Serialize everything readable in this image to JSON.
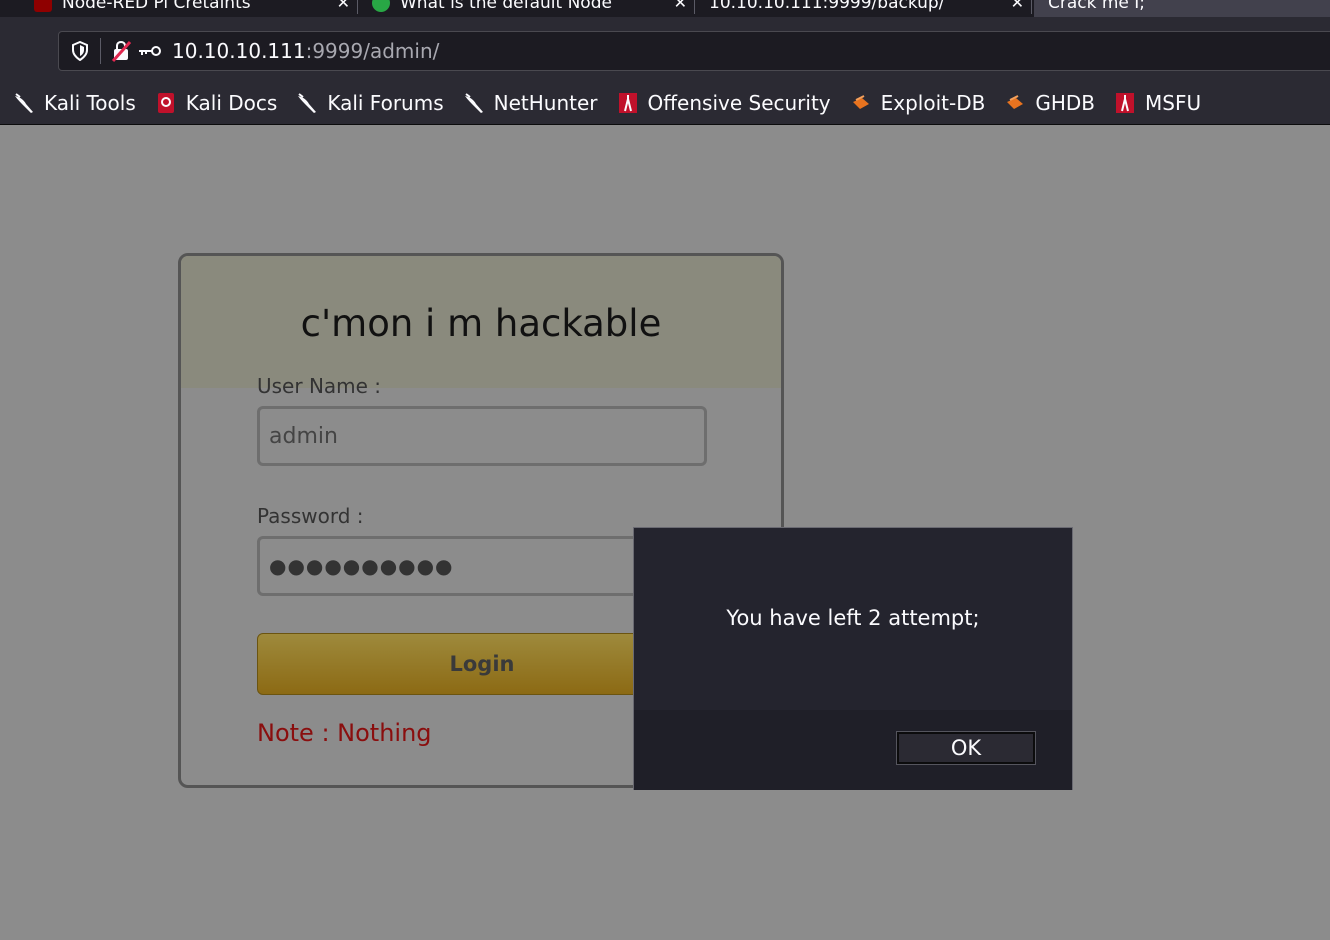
{
  "browser": {
    "tabs": [
      {
        "title": "Node-RED Pi Cretalnts",
        "icon": "node-red-icon",
        "color": "#8f0000"
      },
      {
        "title": "What is the default Node",
        "icon": "chat-bubble-icon",
        "color": "#28a745"
      },
      {
        "title": "10.10.10.111:9999/backup/",
        "icon": "page-icon",
        "color": ""
      },
      {
        "title": "Crack me I;",
        "icon": "page-icon",
        "color": ""
      }
    ],
    "url_host": "10.10.10.111",
    "url_rest": ":9999/admin/",
    "bookmarks": [
      {
        "label": "Kali Tools",
        "icon": "kali-dragon-icon"
      },
      {
        "label": "Kali Docs",
        "icon": "kali-docs-icon"
      },
      {
        "label": "Kali Forums",
        "icon": "kali-dragon-icon"
      },
      {
        "label": "NetHunter",
        "icon": "kali-dragon-icon"
      },
      {
        "label": "Offensive Security",
        "icon": "offsec-icon"
      },
      {
        "label": "Exploit-DB",
        "icon": "exploitdb-icon"
      },
      {
        "label": "GHDB",
        "icon": "exploitdb-icon"
      },
      {
        "label": "MSFU",
        "icon": "offsec-icon"
      }
    ]
  },
  "login": {
    "title": "c'mon i m hackable",
    "username_label": "User Name :",
    "username_value": "admin",
    "password_label": "Password :",
    "password_value": "●●●●●●●●●●",
    "login_button": "Login",
    "note": "Note : Nothing"
  },
  "dialog": {
    "message": "You have left 2 attempt;",
    "ok_label": "OK"
  },
  "colors": {
    "page_background": "#8c8c8c",
    "chrome_background": "#2b2a33",
    "note_color": "#8a0e0e",
    "login_button_gold": "#8c6a14"
  }
}
